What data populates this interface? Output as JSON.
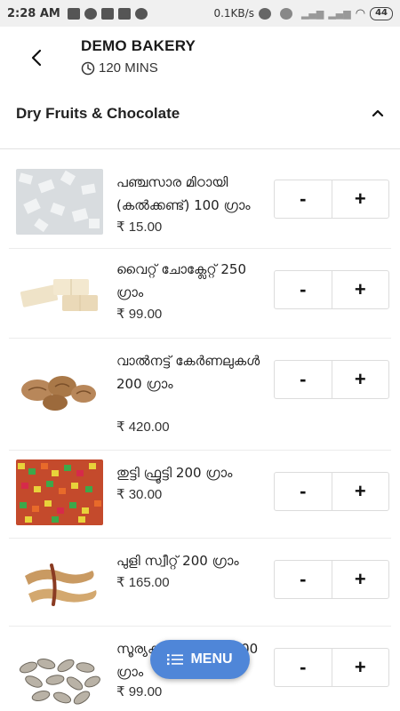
{
  "status_bar": {
    "time": "2:28 AM",
    "net_speed": "0.1KB/s",
    "battery": "44",
    "left_icons": [
      "gmail-icon",
      "whatsapp-icon",
      "gmail-icon",
      "gmail-icon",
      "phone-icon"
    ],
    "right_icons": [
      "headphones-icon",
      "alarm-icon",
      "signal-icon",
      "signal-icon",
      "wifi-icon"
    ]
  },
  "header": {
    "back_icon": "back-arrow-icon",
    "store_name": "DEMO BAKERY",
    "clock_icon": "clock-icon",
    "delivery_time": "120 MINS"
  },
  "category": {
    "title": "Dry Fruits & Chocolate",
    "chevron_icon": "chevron-up-icon",
    "expanded": true
  },
  "items": [
    {
      "name": "പഞ്ചസാര മിഠായി (കൽക്കണ്ട്) 100 ഗ്രാം",
      "price": "₹ 15.00",
      "image": "sugar-candy"
    },
    {
      "name": "വൈറ്റ് ചോക്ലേറ്റ് 250 ഗ്രാം",
      "price": "₹ 99.00",
      "image": "white-chocolate"
    },
    {
      "name": "വാൽനട്ട് കേർണലുകൾ 200 ഗ്രാം",
      "price": "₹ 420.00",
      "image": "walnut"
    },
    {
      "name": "തുട്ടി ഫ്രൂട്ടി 200 ഗ്രാം",
      "price": "₹ 30.00",
      "image": "tutti-frutti"
    },
    {
      "name": "പുളി സ്വീറ്റ് 200 ഗ്രാം",
      "price": "₹ 165.00",
      "image": "tamarind"
    },
    {
      "name": "സൂര്യകാന്തി വിത്ത് 200 ഗ്രാം",
      "price": "₹ 99.00",
      "image": "sunflower-seeds"
    }
  ],
  "stepper": {
    "minus": "-",
    "plus": "+"
  },
  "fab": {
    "label": "MENU",
    "icon": "list-icon",
    "color": "#4f86d8"
  }
}
